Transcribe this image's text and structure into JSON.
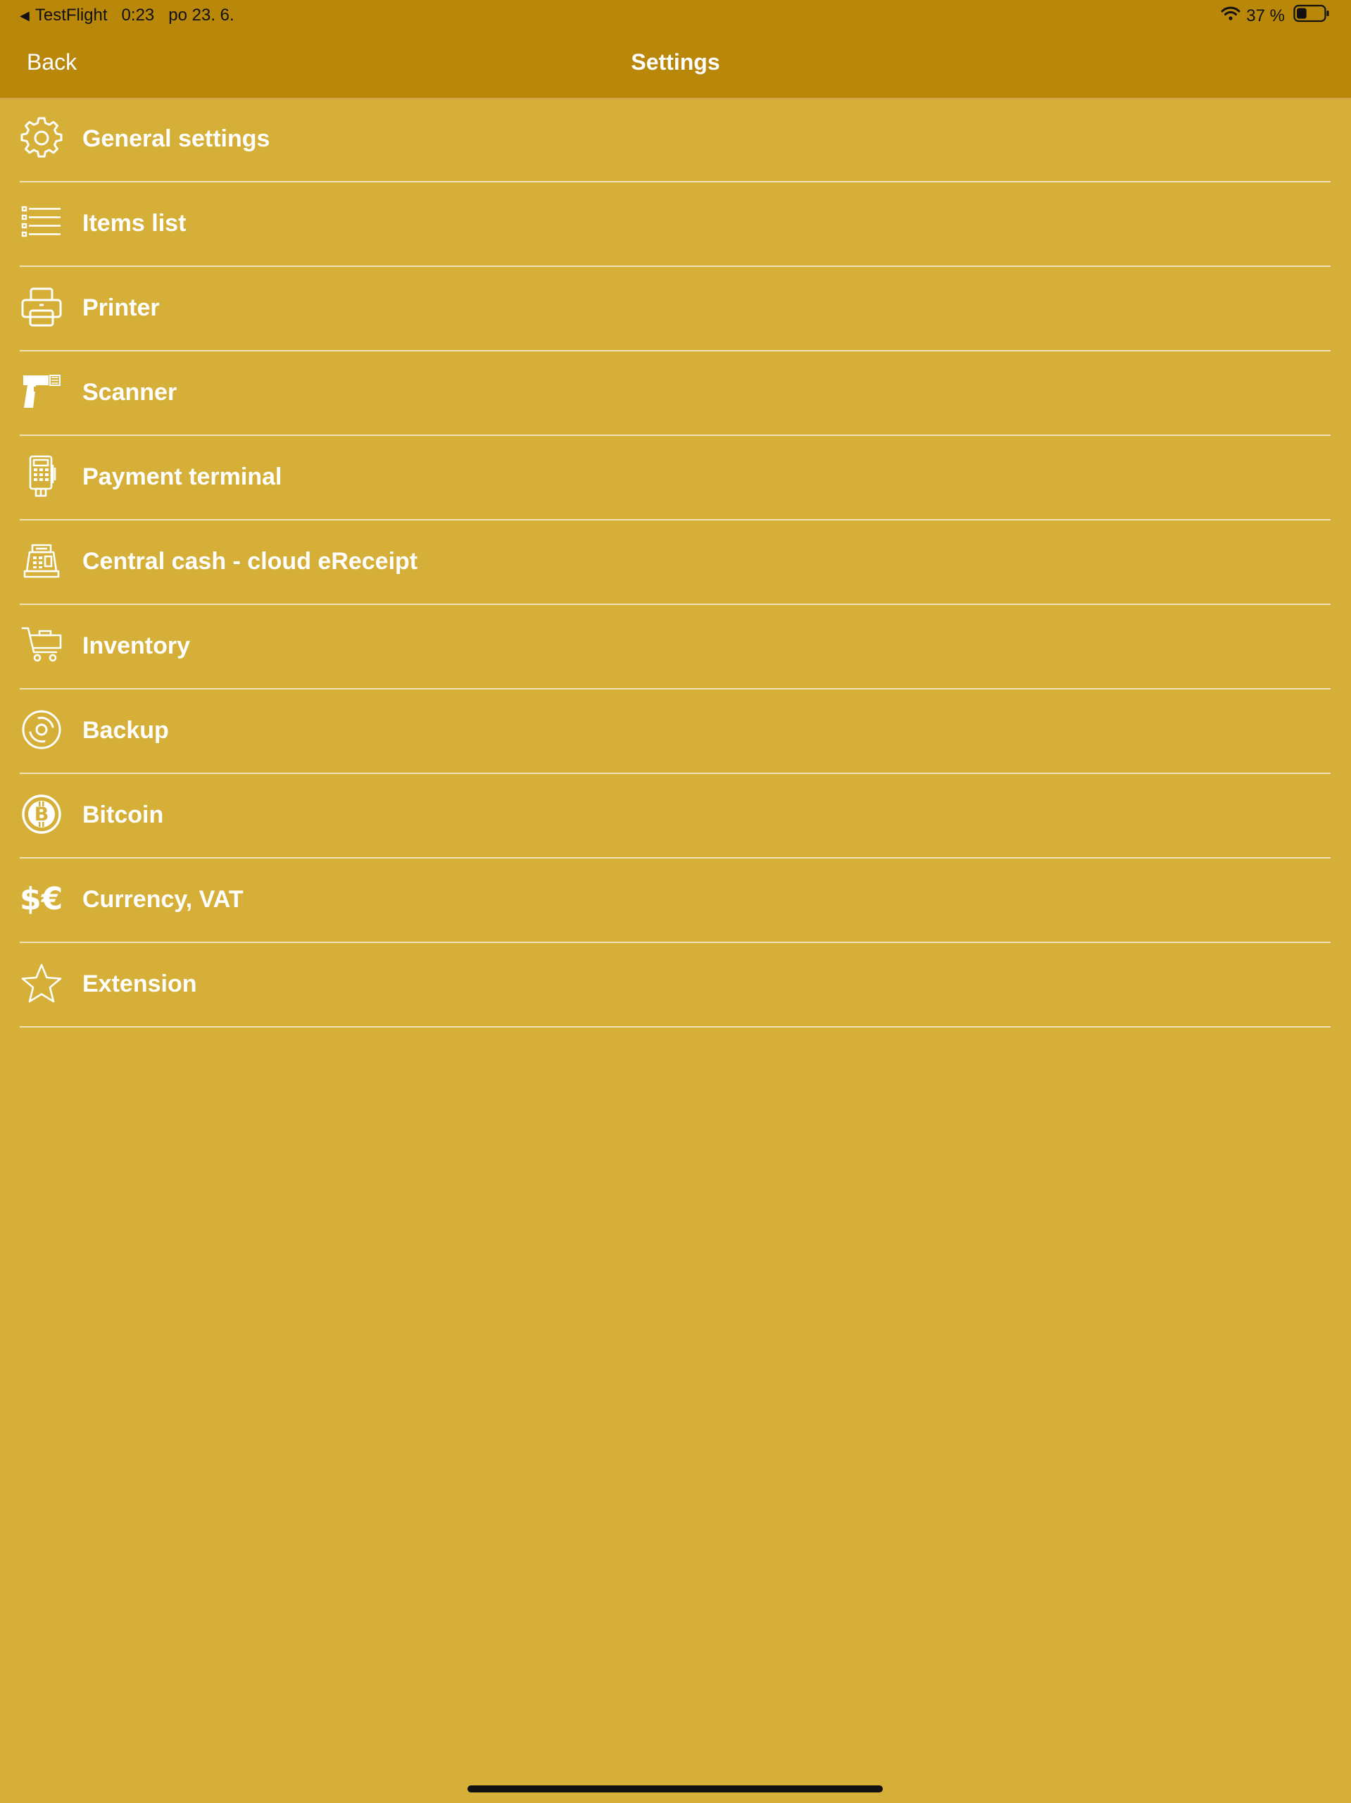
{
  "status_bar": {
    "back_app": "TestFlight",
    "time": "0:23",
    "date": "po 23. 6.",
    "battery_percent": "37 %",
    "battery_level": 0.37
  },
  "nav": {
    "back_label": "Back",
    "title": "Settings"
  },
  "menu": {
    "items": [
      {
        "label": "General settings",
        "icon": "gear-icon"
      },
      {
        "label": "Items list",
        "icon": "list-icon"
      },
      {
        "label": "Printer",
        "icon": "printer-icon"
      },
      {
        "label": "Scanner",
        "icon": "barcode-scanner-icon"
      },
      {
        "label": "Payment terminal",
        "icon": "payment-terminal-icon"
      },
      {
        "label": "Central cash - cloud eReceipt",
        "icon": "cash-register-icon"
      },
      {
        "label": "Inventory",
        "icon": "cart-icon"
      },
      {
        "label": "Backup",
        "icon": "backup-disc-icon"
      },
      {
        "label": "Bitcoin",
        "icon": "bitcoin-icon"
      },
      {
        "label": "Currency, VAT",
        "icon": "currency-icon"
      },
      {
        "label": "Extension",
        "icon": "star-icon"
      }
    ]
  },
  "colors": {
    "background": "#D5AF37",
    "header": "#B9870A",
    "text": "#FFFFFF",
    "divider": "#EFE3B8"
  }
}
